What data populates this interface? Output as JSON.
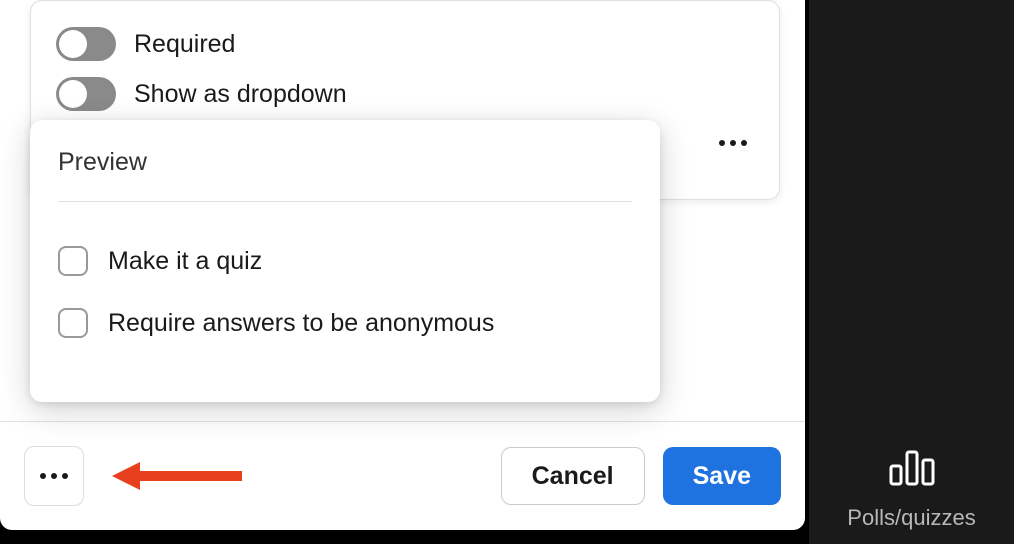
{
  "toggles": {
    "required": {
      "label": "Required"
    },
    "dropdown": {
      "label": "Show as dropdown"
    }
  },
  "popup": {
    "title": "Preview",
    "options": {
      "quiz": {
        "label": "Make it a quiz"
      },
      "anonymous": {
        "label": "Require answers to be anonymous"
      }
    }
  },
  "footer": {
    "cancel": "Cancel",
    "save": "Save"
  },
  "sidebar": {
    "polls_label": "Polls/quizzes"
  }
}
